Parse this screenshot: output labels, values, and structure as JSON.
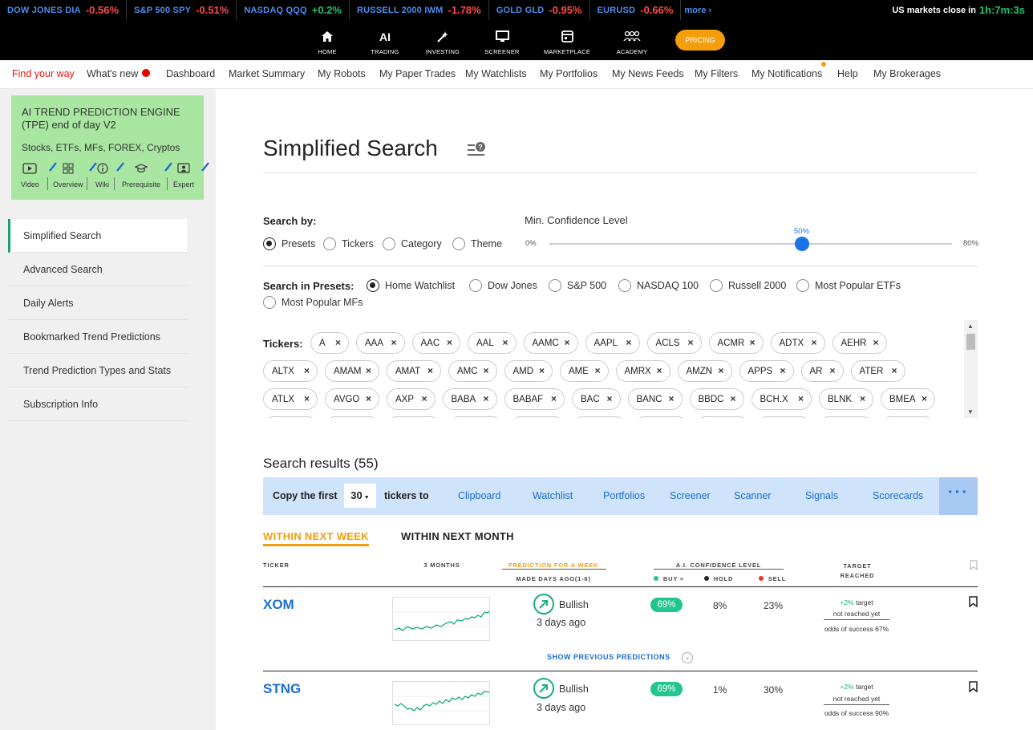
{
  "ticker_bar": {
    "items": [
      {
        "name": "DOW JONES DIA",
        "change": "-0.56%",
        "dir": "neg"
      },
      {
        "name": "S&P 500 SPY",
        "change": "-0.51%",
        "dir": "neg"
      },
      {
        "name": "NASDAQ QQQ",
        "change": "+0.2%",
        "dir": "pos"
      },
      {
        "name": "RUSSELL 2000 IWM",
        "change": "-1.78%",
        "dir": "neg"
      },
      {
        "name": "GOLD GLD",
        "change": "-0.95%",
        "dir": "neg"
      },
      {
        "name": "EURUSD",
        "change": "-0.66%",
        "dir": "neg"
      }
    ],
    "more": "more ›",
    "close_label": "US markets close in",
    "close_time": "1h:7m:3s"
  },
  "main_nav": {
    "items": [
      {
        "label": "HOME",
        "icon": "home-icon"
      },
      {
        "label": "TRADING",
        "icon": "ai-icon",
        "icon_text": "AI"
      },
      {
        "label": "INVESTING",
        "icon": "wand-icon"
      },
      {
        "label": "SCREENER",
        "icon": "monitor-icon"
      },
      {
        "label": "MARKETPLACE",
        "icon": "store-icon"
      },
      {
        "label": "ACADEMY",
        "icon": "people-icon"
      }
    ],
    "pricing": "PRICING"
  },
  "sub_nav": {
    "items": [
      "Find your way",
      "What's new",
      "Dashboard",
      "Market Summary",
      "My Robots",
      "My Paper Trades",
      "My Watchlists",
      "My Portfolios",
      "My News Feeds",
      "My Filters",
      "My Notifications",
      "Help",
      "My Brokerages"
    ]
  },
  "sidebar": {
    "card": {
      "title": "AI TREND PREDICTION ENGINE (TPE) end of day V2",
      "subtitle": "Stocks, ETFs, MFs, FOREX, Cryptos",
      "links": [
        "Video",
        "Overview",
        "Wiki",
        "Prerequisite",
        "Expert"
      ]
    },
    "menu": [
      "Simplified Search",
      "Advanced Search",
      "Daily Alerts",
      "Bookmarked Trend Predictions",
      "Trend Prediction Types and Stats",
      "Subscription Info"
    ]
  },
  "main": {
    "title": "Simplified Search",
    "search_by": {
      "label": "Search by:",
      "options": [
        "Presets",
        "Tickers",
        "Category",
        "Theme"
      ],
      "selected": "Presets"
    },
    "confidence": {
      "label": "Min. Confidence Level",
      "min": "0%",
      "max": "80%",
      "value_label": "50%",
      "value": 50
    },
    "presets": {
      "label": "Search in Presets:",
      "options": [
        "Home Watchlist",
        "Dow Jones",
        "S&P 500",
        "NASDAQ 100",
        "Russell 2000",
        "Most Popular ETFs",
        "Most Popular MFs"
      ],
      "selected": "Home Watchlist"
    },
    "tickers": {
      "label": "Tickers:",
      "rows": [
        [
          "A",
          "AAA",
          "AAC",
          "AAL",
          "AAMC",
          "AAPL",
          "ACLS",
          "ACMR",
          "ADTX",
          "AEHR"
        ],
        [
          "ALTX",
          "AMAM",
          "AMAT",
          "AMC",
          "AMD",
          "AME",
          "AMRX",
          "AMZN",
          "APPS",
          "AR",
          "ATER"
        ],
        [
          "ATLX",
          "AVGO",
          "AXP",
          "BABA",
          "BABAF",
          "BAC",
          "BANC",
          "BBDC",
          "BCH.X",
          "BLNK",
          "BMEA"
        ]
      ]
    },
    "results": {
      "title": "Search results (55)",
      "copy": {
        "prefix": "Copy the first",
        "count": "30",
        "suffix": "tickers to",
        "targets": [
          "Clipboard",
          "Watchlist",
          "Portfolios",
          "Screener",
          "Scanner",
          "Signals",
          "Scorecards"
        ],
        "more": "···"
      },
      "tabs": [
        "WITHIN NEXT WEEK",
        "WITHIN NEXT MONTH"
      ],
      "headers": {
        "ticker": "TICKER",
        "months": "3 MONTHS",
        "prediction": "PREDICTION FOR A WEEK",
        "made_ago": "MADE DAYS AGO(1-6)",
        "confidence": "A.I. CONFIDENCE LEVEL",
        "buy": "BUY",
        "hold": "HOLD",
        "sell": "SELL",
        "target": "TARGET REACHED"
      },
      "rows": [
        {
          "symbol": "XOM",
          "direction": "Bullish",
          "days": "3 days ago",
          "buy": "69%",
          "hold": "8%",
          "sell": "23%",
          "target_pct": "+2%",
          "target_word": "target",
          "target_status": "not reached yet",
          "odds": "odds of success 67%"
        },
        {
          "symbol": "STNG",
          "direction": "Bullish",
          "days": "3 days ago",
          "buy": "69%",
          "hold": "1%",
          "sell": "30%",
          "target_pct": "+2%",
          "target_word": "target",
          "target_status": "not reached yet",
          "odds": "odds of success 90%"
        }
      ],
      "show_previous": "SHOW PREVIOUS PREDICTIONS"
    }
  }
}
